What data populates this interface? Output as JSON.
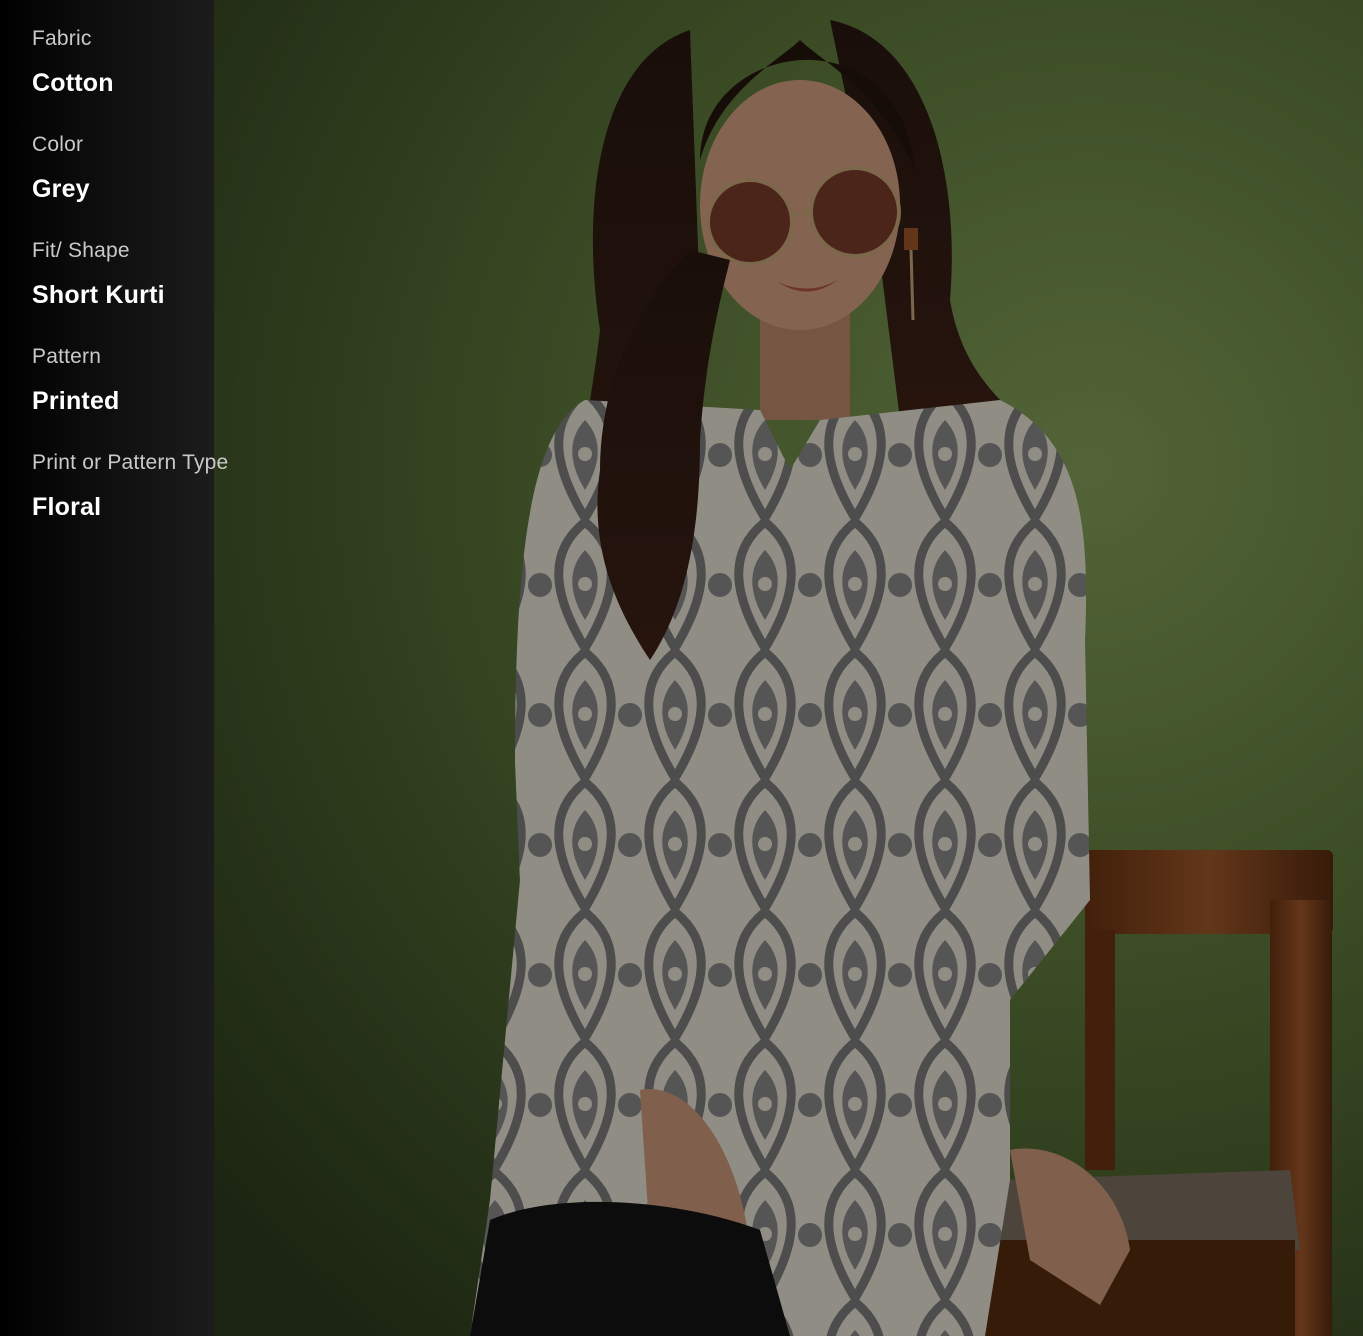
{
  "attributes": [
    {
      "label": "Fabric",
      "value": "Cotton"
    },
    {
      "label": "Color",
      "value": "Grey"
    },
    {
      "label": "Fit/ Shape",
      "value": "Short Kurti"
    },
    {
      "label": "Pattern",
      "value": "Printed"
    },
    {
      "label": "Print or Pattern Type",
      "value": "Floral"
    }
  ],
  "colors": {
    "background_wall": "#5f7a3c",
    "panel": "#111111",
    "label_text": "#c9c9c9",
    "value_text": "#ffffff",
    "kurti_base": "#ece8d8",
    "kurti_print": "#7a7a7a",
    "chair_wood": "#8a4a1c"
  }
}
